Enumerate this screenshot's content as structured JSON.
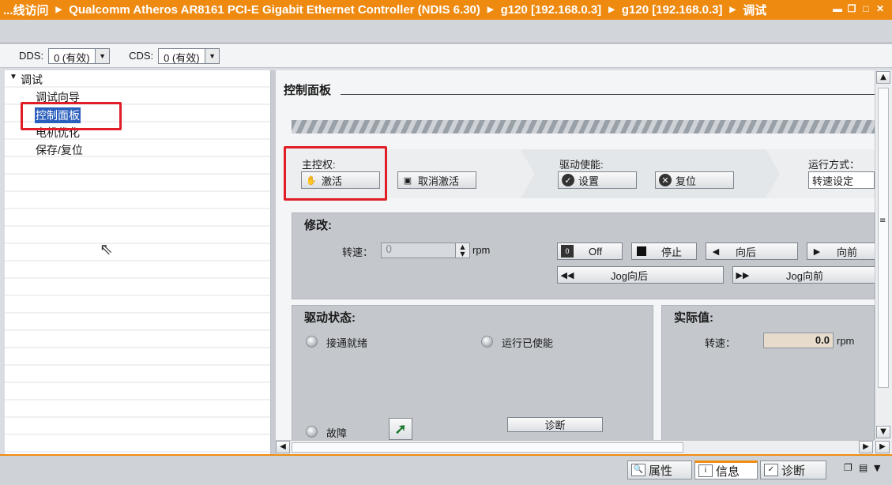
{
  "titlebar": {
    "crumbs": [
      "...线访问",
      "Qualcomm Atheros AR8161 PCI-E Gigabit Ethernet Controller (NDIS 6.30)",
      "g120 [192.168.0.3]",
      "g120 [192.168.0.3]",
      "调试"
    ],
    "accent_color": "#ef8a11"
  },
  "toolbar": {
    "dds_label": "DDS:",
    "dds_value": "0 (有效)",
    "cds_label": "CDS:",
    "cds_value": "0 (有效)"
  },
  "tree": {
    "root": "调试",
    "items": [
      "调试向导",
      "控制面板",
      "电机优化",
      "保存/复位"
    ],
    "selected": "控制面板"
  },
  "panel": {
    "title": "控制面板",
    "master_label": "主控权:",
    "activate_label": "激活",
    "deactivate_label": "取消激活",
    "drive_enable_label": "驱动使能:",
    "set_label": "设置",
    "reset_label": "复位",
    "run_mode_label": "运行方式：",
    "run_mode_value": "转速设定",
    "modify_title": "修改:",
    "speed_label": "转速：",
    "speed_value": "0",
    "speed_unit": "rpm",
    "off_label": "Off",
    "stop_label": "停止",
    "backward_label": "向后",
    "forward_label": "向前",
    "jog_backward_label": "Jog向后",
    "jog_forward_label": "Jog向前",
    "state_title": "驱动状态:",
    "ready_label": "接通就绪",
    "run_enabled_label": "运行已使能",
    "fault_label": "故障",
    "diag_label": "诊断",
    "actual_title": "实际值:",
    "actual_speed_label": "转速：",
    "actual_speed_value": "0.0",
    "actual_speed_unit": "rpm"
  },
  "bottom": {
    "tabs": [
      "属性",
      "信息",
      "诊断"
    ],
    "active_tab": "信息"
  }
}
